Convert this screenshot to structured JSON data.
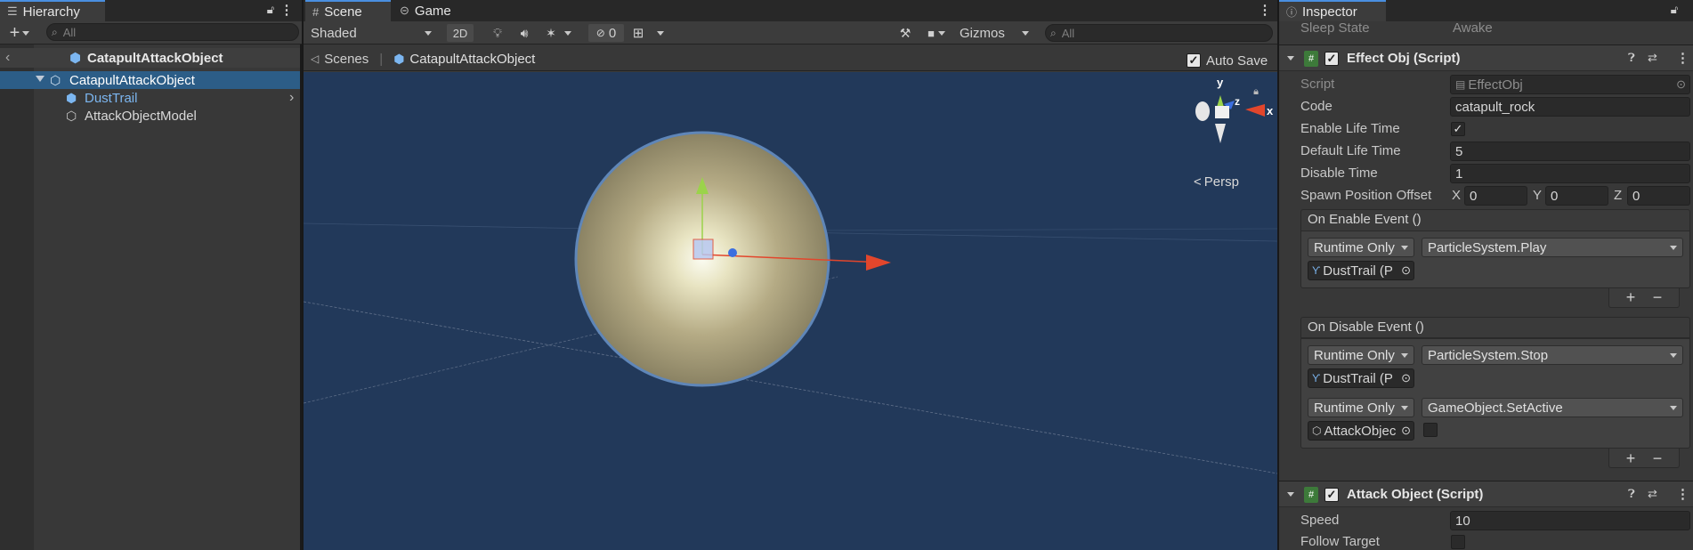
{
  "hierarchy": {
    "tab_label": "Hierarchy",
    "search_placeholder": "All",
    "scene_title": "CatapultAttackObject",
    "items": [
      {
        "label": "CatapultAttackObject"
      },
      {
        "label": "DustTrail"
      },
      {
        "label": "AttackObjectModel"
      }
    ]
  },
  "scene": {
    "tabs": [
      {
        "label": "Scene"
      },
      {
        "label": "Game"
      }
    ],
    "shading_mode": "Shaded",
    "mode_2d": "2D",
    "hidden_count": "0",
    "gizmos_label": "Gizmos",
    "search_placeholder": "All",
    "breadcrumb": {
      "root": "Scenes",
      "current": "CatapultAttackObject"
    },
    "auto_save_label": "Auto Save",
    "auto_save_checked": true,
    "axis_labels": {
      "y": "y",
      "x": "x",
      "z": "z"
    },
    "projection_label": "Persp",
    "background_color": "#22395a"
  },
  "inspector": {
    "tab_label": "Inspector",
    "top_clipped_label": "Sleep State",
    "top_clipped_value": "Awake",
    "effect_component": {
      "title": "Effect Obj (Script)",
      "script_label": "Script",
      "script_value": "EffectObj",
      "code_label": "Code",
      "code_value": "catapult_rock",
      "enable_life_time_label": "Enable Life Time",
      "enable_life_time_checked": true,
      "default_life_time_label": "Default Life Time",
      "default_life_time_value": "5",
      "disable_time_label": "Disable Time",
      "disable_time_value": "1",
      "spawn_offset_label": "Spawn Position Offset",
      "spawn_offset": {
        "x_label": "X",
        "x": "0",
        "y_label": "Y",
        "y": "0",
        "z_label": "Z",
        "z": "0"
      },
      "on_enable_event": {
        "title": "On Enable Event ()",
        "calls": [
          {
            "mode": "Runtime Only",
            "function": "ParticleSystem.Play",
            "target": "DustTrail (P"
          }
        ]
      },
      "on_disable_event": {
        "title": "On Disable Event ()",
        "calls": [
          {
            "mode": "Runtime Only",
            "function": "ParticleSystem.Stop",
            "target": "DustTrail (P"
          },
          {
            "mode": "Runtime Only",
            "function": "GameObject.SetActive",
            "target": "AttackObjec"
          }
        ]
      },
      "add_label": "+",
      "remove_label": "−"
    },
    "attack_component": {
      "title": "Attack Object (Script)",
      "speed_label": "Speed",
      "speed_value": "10",
      "follow_target_label": "Follow Target"
    }
  },
  "colors": {
    "selection": "#2c5d87",
    "accent": "#4a8fe0",
    "prefab_blue": "#7cb6f0"
  }
}
